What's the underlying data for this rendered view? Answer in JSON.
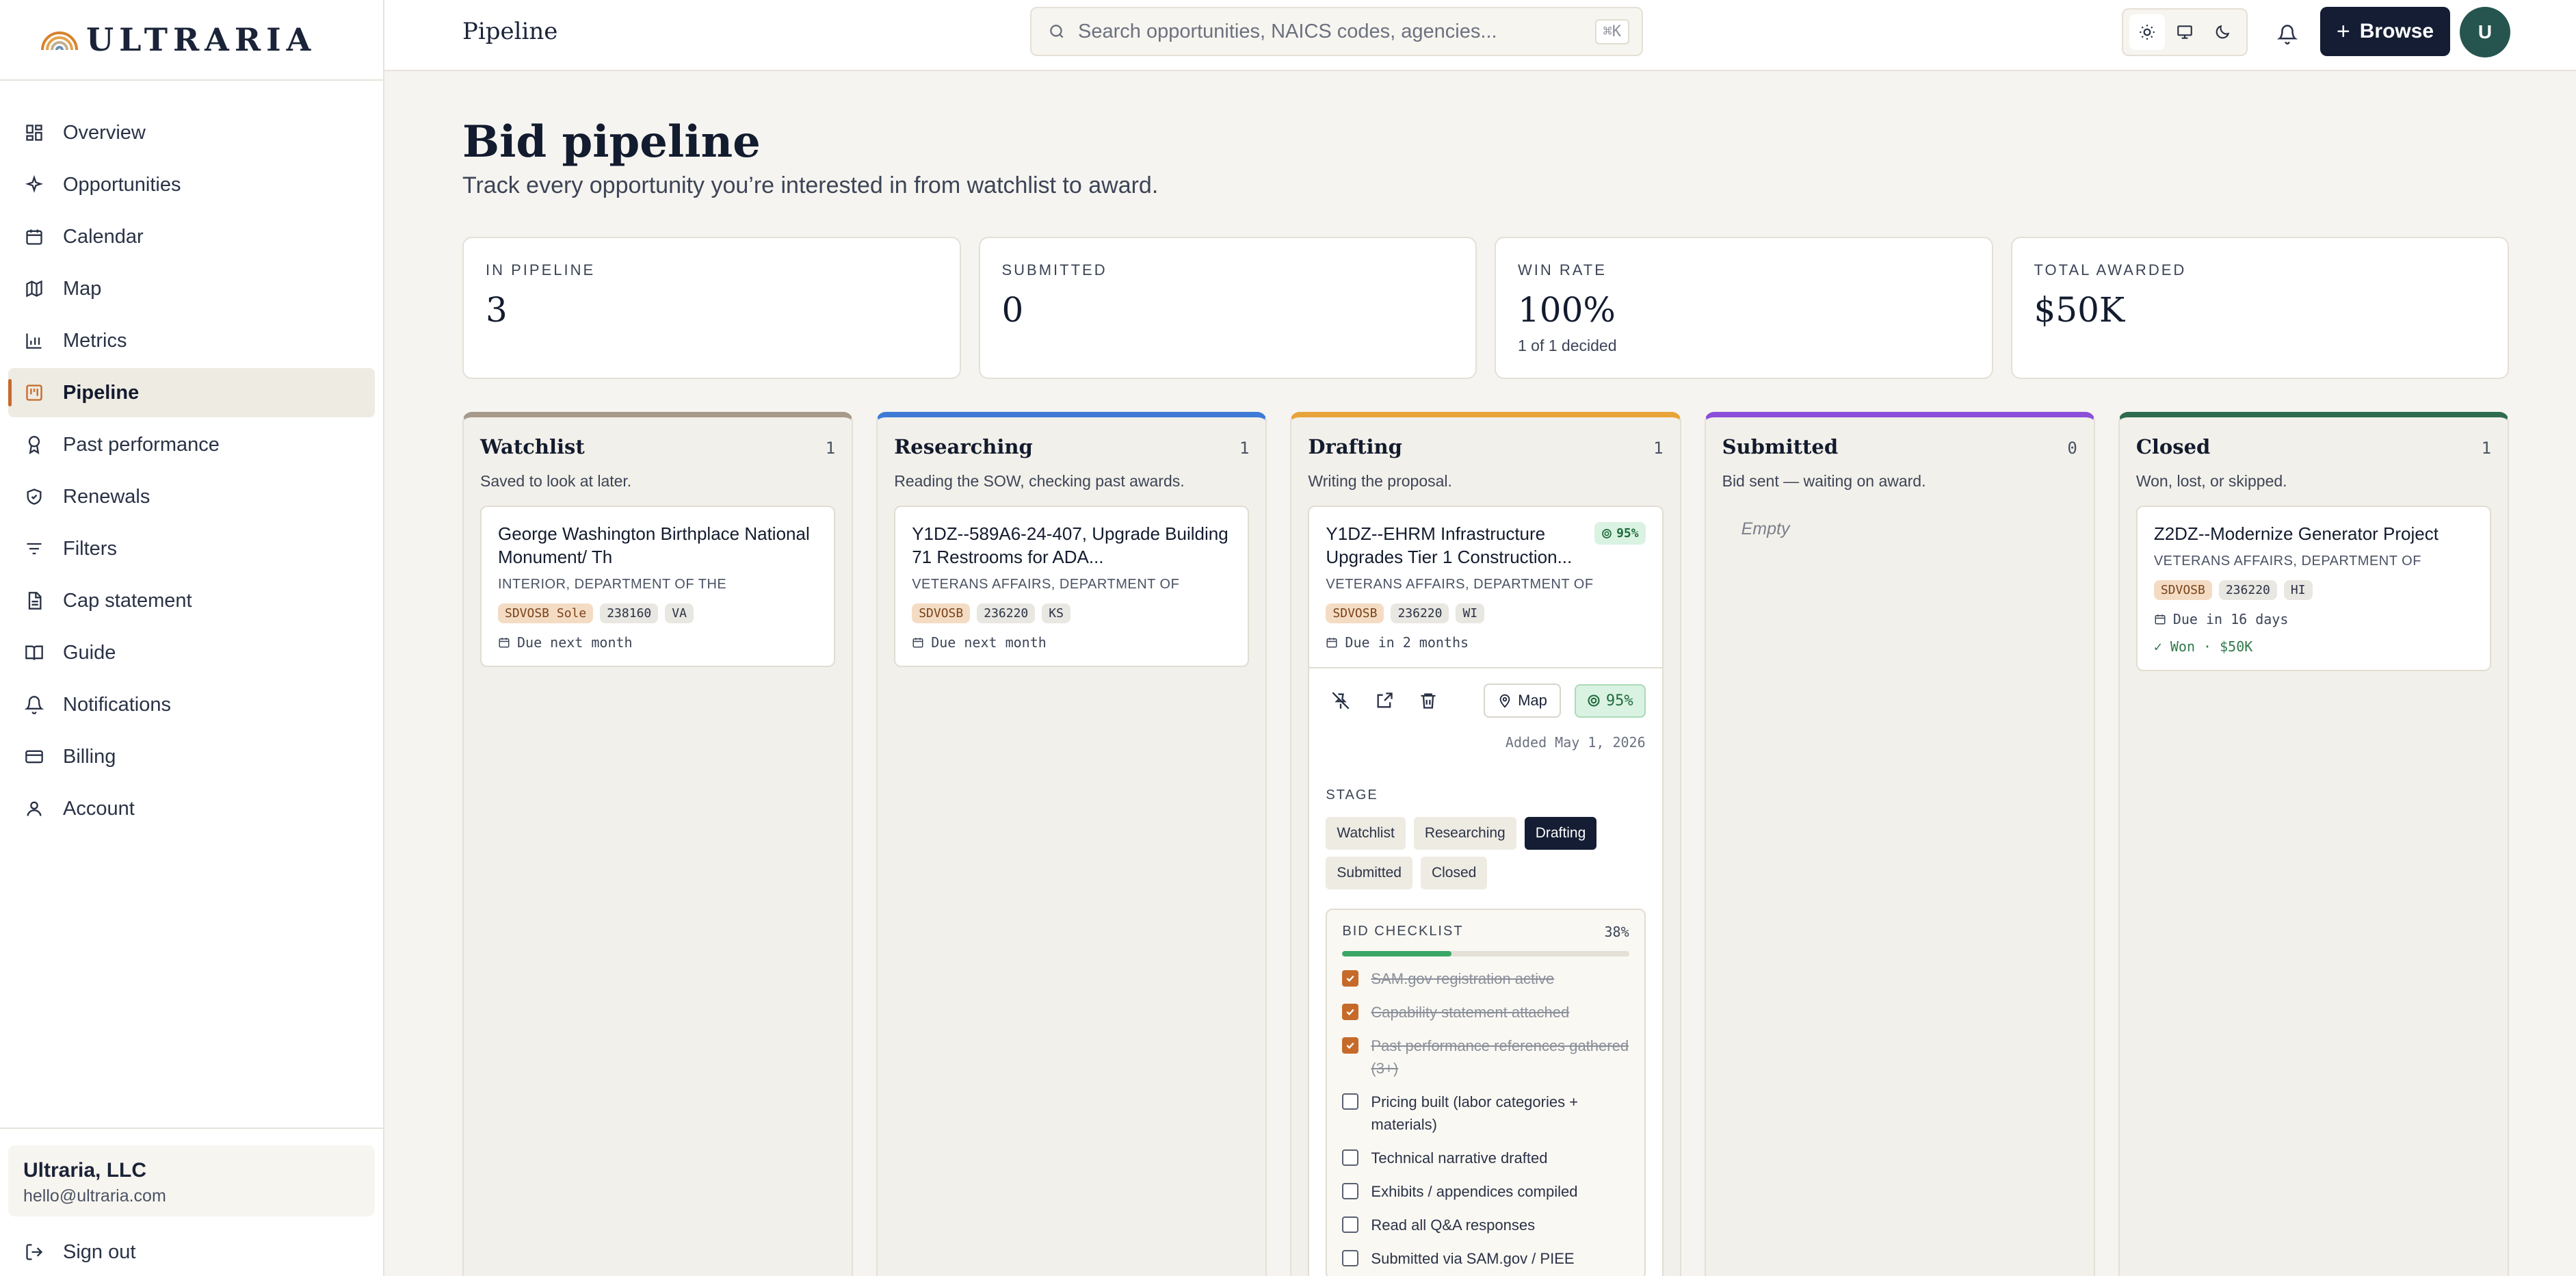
{
  "brand": {
    "name": "ULTRARIA"
  },
  "sidebar": {
    "items": [
      {
        "label": "Overview",
        "icon": "grid-icon"
      },
      {
        "label": "Opportunities",
        "icon": "sparkle-icon"
      },
      {
        "label": "Calendar",
        "icon": "calendar-icon"
      },
      {
        "label": "Map",
        "icon": "map-icon"
      },
      {
        "label": "Metrics",
        "icon": "bar-chart-icon"
      },
      {
        "label": "Pipeline",
        "icon": "kanban-icon",
        "active": true
      },
      {
        "label": "Past performance",
        "icon": "award-icon"
      },
      {
        "label": "Renewals",
        "icon": "shield-check-icon"
      },
      {
        "label": "Filters",
        "icon": "filter-icon"
      },
      {
        "label": "Cap statement",
        "icon": "document-icon"
      },
      {
        "label": "Guide",
        "icon": "book-icon"
      },
      {
        "label": "Notifications",
        "icon": "bell-icon"
      },
      {
        "label": "Billing",
        "icon": "credit-card-icon"
      },
      {
        "label": "Account",
        "icon": "user-icon"
      }
    ],
    "account": {
      "name": "Ultraria, LLC",
      "email": "hello@ultraria.com"
    },
    "signout": "Sign out"
  },
  "topbar": {
    "title": "Pipeline",
    "search_placeholder": "Search opportunities, NAICS codes, agencies...",
    "search_shortcut": "⌘K",
    "browse_label": "Browse",
    "avatar_initial": "U"
  },
  "page": {
    "title": "Bid pipeline",
    "subtitle": "Track every opportunity you’re interested in from watchlist to award."
  },
  "stats": [
    {
      "label": "IN PIPELINE",
      "value": "3",
      "note": ""
    },
    {
      "label": "SUBMITTED",
      "value": "0",
      "note": ""
    },
    {
      "label": "WIN RATE",
      "value": "100%",
      "note": "1 of 1 decided"
    },
    {
      "label": "TOTAL AWARDED",
      "value": "$50K",
      "note": ""
    }
  ],
  "columns": {
    "watchlist": {
      "title": "Watchlist",
      "count": "1",
      "desc": "Saved to look at later.",
      "color": "#a89a8a",
      "card": {
        "title": "George Washington Birthplace National Monument/ Th",
        "agency": "INTERIOR, DEPARTMENT OF THE",
        "tags": [
          "SDVOSB Sole",
          "238160",
          "VA"
        ],
        "due": "Due next month"
      }
    },
    "researching": {
      "title": "Researching",
      "count": "1",
      "desc": "Reading the SOW, checking past awards.",
      "color": "#3f7ad6",
      "card": {
        "title": "Y1DZ--589A6-24-407, Upgrade Building 71 Restrooms for ADA...",
        "agency": "VETERANS AFFAIRS, DEPARTMENT OF",
        "tags": [
          "SDVOSB",
          "236220",
          "KS"
        ],
        "due": "Due next month"
      }
    },
    "drafting": {
      "title": "Drafting",
      "count": "1",
      "desc": "Writing the proposal.",
      "color": "#e8a33a",
      "card": {
        "title": "Y1DZ--EHRM Infrastructure Upgrades Tier 1 Construction...",
        "score": "95%",
        "agency": "VETERANS AFFAIRS, DEPARTMENT OF",
        "tags": [
          "SDVOSB",
          "236220",
          "WI"
        ],
        "due": "Due in 2 months",
        "map_label": "Map",
        "score_button": "95%",
        "added": "Added May 1, 2026",
        "stage_label": "STAGE",
        "stages": [
          "Watchlist",
          "Researching",
          "Drafting",
          "Submitted",
          "Closed"
        ],
        "active_stage": "Drafting",
        "checklist": {
          "title": "BID CHECKLIST",
          "percent": "38%",
          "progress": 0.38,
          "items": [
            {
              "text": "SAM.gov registration active",
              "done": true
            },
            {
              "text": "Capability statement attached",
              "done": true
            },
            {
              "text": "Past performance references gathered (3+)",
              "done": true
            },
            {
              "text": "Pricing built (labor categories + materials)",
              "done": false
            },
            {
              "text": "Technical narrative drafted",
              "done": false
            },
            {
              "text": "Exhibits / appendices compiled",
              "done": false
            },
            {
              "text": "Read all Q&A responses",
              "done": false
            },
            {
              "text": "Submitted via SAM.gov / PIEE",
              "done": false
            }
          ]
        }
      }
    },
    "submitted": {
      "title": "Submitted",
      "count": "0",
      "desc": "Bid sent — waiting on award.",
      "color": "#8b4fd9",
      "empty": "Empty"
    },
    "closed": {
      "title": "Closed",
      "count": "1",
      "desc": "Won, lost, or skipped.",
      "color": "#2f6b4c",
      "card": {
        "title": "Z2DZ--Modernize Generator Project",
        "agency": "VETERANS AFFAIRS, DEPARTMENT OF",
        "tags": [
          "SDVOSB",
          "236220",
          "HI"
        ],
        "due": "Due in 16 days",
        "result": "✓ Won · $50K"
      }
    }
  }
}
